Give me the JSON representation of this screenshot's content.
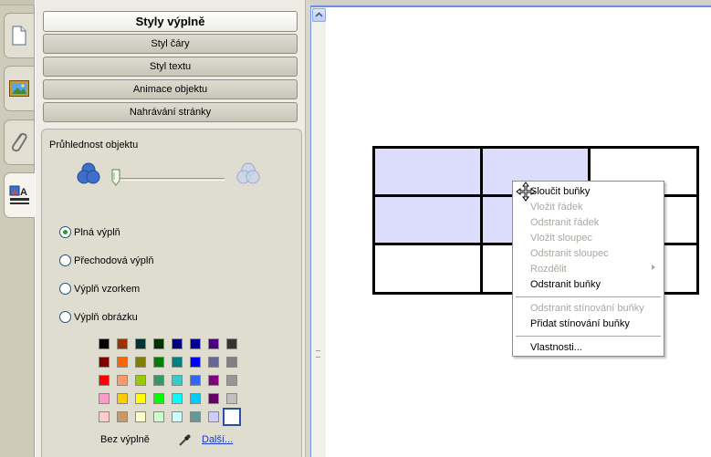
{
  "tabs": [
    {
      "icon": "document-icon"
    },
    {
      "icon": "picture-icon"
    },
    {
      "icon": "paperclip-icon"
    },
    {
      "icon": "fill-properties-icon"
    }
  ],
  "panel": {
    "sections": [
      {
        "label": "Styly výplně",
        "active": true
      },
      {
        "label": "Styl čáry"
      },
      {
        "label": "Styl textu"
      },
      {
        "label": "Animace objektu"
      },
      {
        "label": "Nahrávání stránky"
      }
    ],
    "opacity_label": "Průhlednost objektu",
    "opacity_value": 0.0,
    "fill_options": [
      {
        "label": "Plná výplň",
        "checked": true
      },
      {
        "label": "Přechodová výplň",
        "checked": false
      },
      {
        "label": "Výplň vzorkem",
        "checked": false
      },
      {
        "label": "Výplň obrázku",
        "checked": false
      }
    ],
    "palette": [
      [
        "#000000",
        "#993300",
        "#003333",
        "#003300",
        "#000080",
        "#000099",
        "#4b0082",
        "#333333"
      ],
      [
        "#800000",
        "#ff6600",
        "#808000",
        "#008000",
        "#008080",
        "#0000ff",
        "#666699",
        "#808080"
      ],
      [
        "#ff0000",
        "#ff9966",
        "#99cc00",
        "#339966",
        "#33cccc",
        "#3366ff",
        "#800080",
        "#969696"
      ],
      [
        "#ff99cc",
        "#ffcc00",
        "#ffff00",
        "#00ff00",
        "#00ffff",
        "#00ccff",
        "#660066",
        "#c0c0c0"
      ],
      [
        "#ffcccc",
        "#cc9966",
        "#ffffcc",
        "#ccffcc",
        "#ccffff",
        "#669999",
        "#ccccff",
        "#ffffff"
      ]
    ],
    "selected_swatch": "#ffffff",
    "no_fill_label": "Bez výplně",
    "more_link": "Další..."
  },
  "canvas": {
    "table": {
      "rows": 3,
      "cols": 3,
      "shaded_cells": [
        [
          0,
          0
        ],
        [
          0,
          1
        ],
        [
          1,
          0
        ],
        [
          1,
          1
        ]
      ],
      "shade_color": "#dcdcfd"
    }
  },
  "context_menu": {
    "items": [
      {
        "label": "Sloučit buňky",
        "enabled": true
      },
      {
        "label": "Vložit řádek",
        "enabled": false
      },
      {
        "label": "Odstranit řádek",
        "enabled": false
      },
      {
        "label": "Vložit sloupec",
        "enabled": false
      },
      {
        "label": "Odstranit sloupec",
        "enabled": false
      },
      {
        "label": "Rozdělit",
        "enabled": false,
        "submenu": true
      },
      {
        "label": "Odstranit buňky",
        "enabled": true
      },
      {
        "separator": true
      },
      {
        "label": "Odstranit stínování buňky",
        "enabled": false
      },
      {
        "label": "Přidat stínování buňky",
        "enabled": true
      },
      {
        "separator": true
      },
      {
        "label": "Vlastnosti...",
        "enabled": true
      }
    ]
  }
}
